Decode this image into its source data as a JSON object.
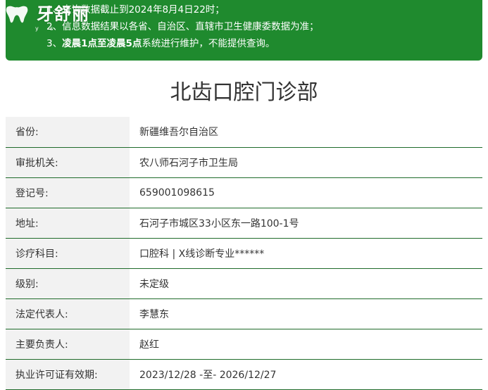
{
  "notice": {
    "line1": "1、查询数据截止到2024年8月4日22时；",
    "line2": "2、信息数据结果以各省、自治区、直辖市卫生健康委数据为准；",
    "line3_prefix": "3、",
    "line3_bold": "凌晨1点至凌晨5点",
    "line3_suffix": "系统进行维护，不能提供查询。"
  },
  "logo": {
    "name": "牙舒丽",
    "sub": "y s l"
  },
  "page_title": "北齿口腔门诊部",
  "rows": [
    {
      "label": "省份:",
      "value": "新疆维吾尔自治区"
    },
    {
      "label": "审批机关:",
      "value": "农八师石河子市卫生局"
    },
    {
      "label": "登记号:",
      "value": "659001098615"
    },
    {
      "label": "地址:",
      "value": "石河子市城区33小区东一路100-1号"
    },
    {
      "label": "诊疗科目:",
      "value": "口腔科 | X线诊断专业******"
    },
    {
      "label": "级别:",
      "value": "未定级"
    },
    {
      "label": "法定代表人:",
      "value": "李慧东"
    },
    {
      "label": "主要负责人:",
      "value": "赵红"
    },
    {
      "label": "执业许可证有效期:",
      "value": "2023/12/28 -至- 2026/12/27"
    }
  ],
  "colors": {
    "notice_bg": "#1f8a2e",
    "row_border": "#1f6b2a",
    "label_bg": "#f2f2f2"
  }
}
